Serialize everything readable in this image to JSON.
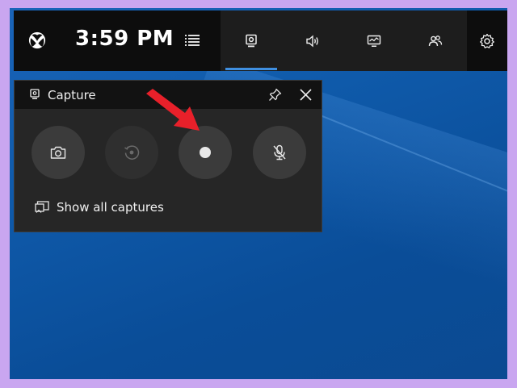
{
  "topbar": {
    "time": "3:59 PM",
    "widgets": [
      {
        "icon": "capture-widget-icon",
        "active": true
      },
      {
        "icon": "audio-icon",
        "active": false
      },
      {
        "icon": "performance-icon",
        "active": false
      },
      {
        "icon": "social-icon",
        "active": false
      }
    ],
    "settings_icon": "gear-icon"
  },
  "capture_panel": {
    "title": "Capture",
    "buttons": [
      {
        "icon": "camera-icon",
        "enabled": true
      },
      {
        "icon": "record-last-icon",
        "enabled": false
      },
      {
        "icon": "record-dot-icon",
        "enabled": true
      },
      {
        "icon": "mic-off-icon",
        "enabled": true
      }
    ],
    "show_all_label": "Show all captures"
  },
  "colors": {
    "desktop": "#0f5aaa",
    "panel": "#262626",
    "header": "#121212",
    "accent": "#3f8fe0",
    "arrow": "#e8202a",
    "page_border": "#c9a6f0"
  }
}
